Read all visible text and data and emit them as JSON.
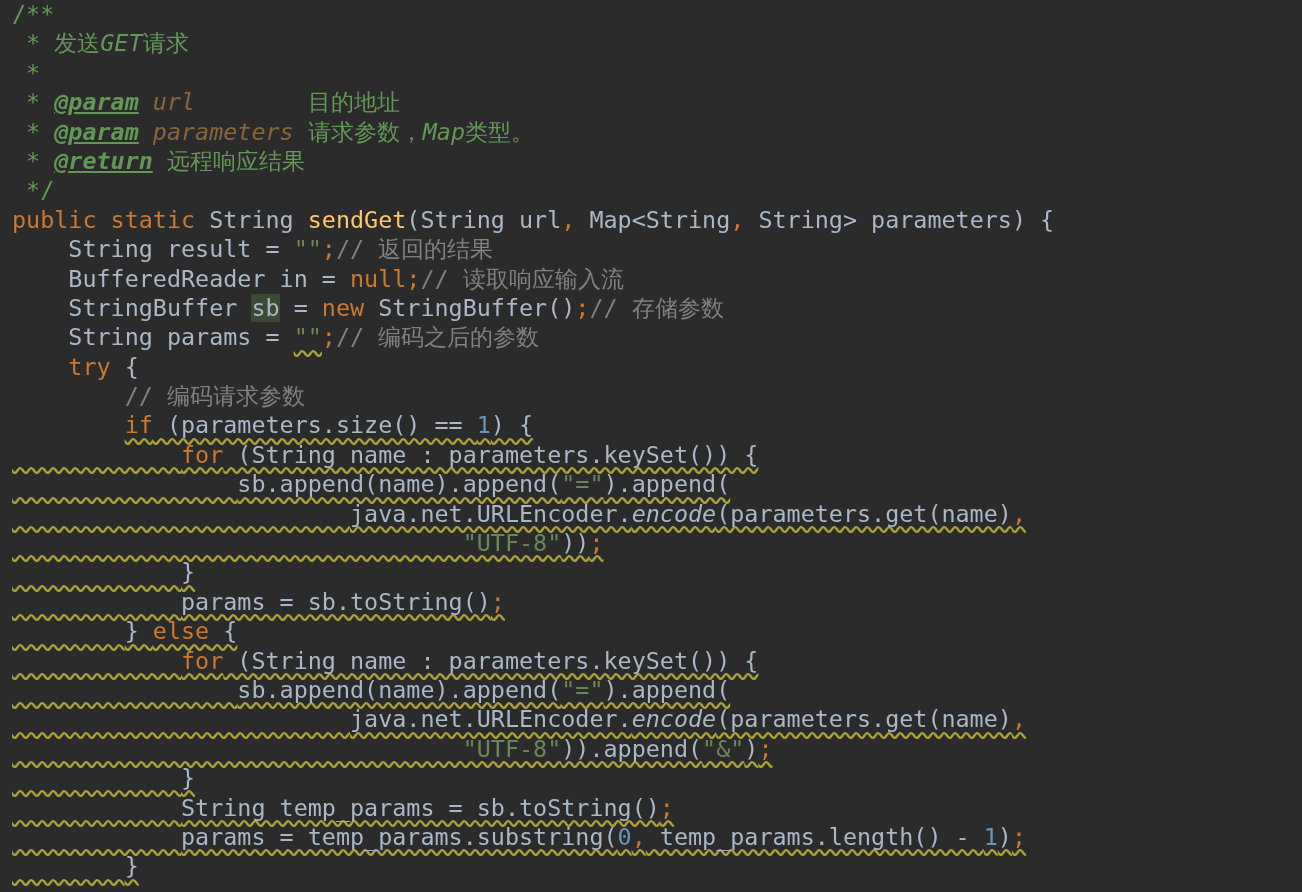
{
  "editor": {
    "lines": [
      {
        "tokens": [
          {
            "text": "/**",
            "kind": "doc"
          }
        ]
      },
      {
        "indent_warning": false,
        "tokens": [
          {
            "text": " * 发送",
            "kind": "doc"
          },
          {
            "text": "GET",
            "kind": "doc-code"
          },
          {
            "text": "请求",
            "kind": "doc"
          }
        ]
      },
      {
        "indent_warning": false,
        "tokens": [
          {
            "text": " *",
            "kind": "doc"
          }
        ]
      },
      {
        "indent_warning": false,
        "tokens": [
          {
            "text": " * ",
            "kind": "doc"
          },
          {
            "text": "@param",
            "kind": "doc-tag"
          },
          {
            "text": " url",
            "kind": "doc-param"
          },
          {
            "text": "        目的地址",
            "kind": "doc"
          }
        ]
      },
      {
        "indent_warning": false,
        "tokens": [
          {
            "text": " * ",
            "kind": "doc"
          },
          {
            "text": "@param",
            "kind": "doc-tag"
          },
          {
            "text": " parameters",
            "kind": "doc-param"
          },
          {
            "text": " 请求参数，",
            "kind": "doc"
          },
          {
            "text": "Map",
            "kind": "doc-code"
          },
          {
            "text": "类型。",
            "kind": "doc"
          }
        ]
      },
      {
        "indent_warning": false,
        "tokens": [
          {
            "text": " * ",
            "kind": "doc"
          },
          {
            "text": "@return",
            "kind": "doc-tag"
          },
          {
            "text": " 远程响应结果",
            "kind": "doc"
          }
        ]
      },
      {
        "indent_warning": false,
        "tokens": [
          {
            "text": " */",
            "kind": "doc"
          }
        ]
      },
      {
        "tokens": [
          {
            "text": "public static",
            "kind": "keyword"
          },
          {
            "text": " String ",
            "kind": "plain"
          },
          {
            "text": "sendGet",
            "kind": "function"
          },
          {
            "text": "(String url",
            "kind": "plain"
          },
          {
            "text": ",",
            "kind": "keyword"
          },
          {
            "text": " Map<String",
            "kind": "plain"
          },
          {
            "text": ",",
            "kind": "keyword"
          },
          {
            "text": " String> parameters) {",
            "kind": "plain"
          }
        ]
      },
      {
        "indent_warning": false,
        "tokens": [
          {
            "text": "    String result = ",
            "kind": "plain"
          },
          {
            "text": "\"\"",
            "kind": "string"
          },
          {
            "text": ";",
            "kind": "keyword"
          },
          {
            "text": "// 返回的结果",
            "kind": "comment"
          }
        ]
      },
      {
        "indent_warning": false,
        "tokens": [
          {
            "text": "    BufferedReader in = ",
            "kind": "plain"
          },
          {
            "text": "null;",
            "kind": "keyword"
          },
          {
            "text": "// 读取响应输入流",
            "kind": "comment"
          }
        ]
      },
      {
        "indent_warning": false,
        "tokens": [
          {
            "text": "    StringBuffer ",
            "kind": "plain"
          },
          {
            "text": "sb",
            "kind": "highlight"
          },
          {
            "text": " = ",
            "kind": "plain"
          },
          {
            "text": "new",
            "kind": "keyword"
          },
          {
            "text": " StringBuffer()",
            "kind": "plain"
          },
          {
            "text": ";",
            "kind": "keyword"
          },
          {
            "text": "// 存储参数",
            "kind": "comment"
          }
        ]
      },
      {
        "indent_warning": false,
        "tokens": [
          {
            "text": "    String params = ",
            "kind": "plain"
          },
          {
            "text": "\"\"",
            "kind": "string",
            "warning": true
          },
          {
            "text": ";",
            "kind": "keyword"
          },
          {
            "text": "// 编码之后的参数",
            "kind": "comment"
          }
        ]
      },
      {
        "indent_warning": false,
        "tokens": [
          {
            "text": "    try",
            "kind": "keyword"
          },
          {
            "text": " {",
            "kind": "plain"
          }
        ]
      },
      {
        "indent_warning": false,
        "tokens": [
          {
            "text": "        // 编码请求参数",
            "kind": "comment"
          }
        ]
      },
      {
        "indent_warning": false,
        "tokens": [
          {
            "text": "        if",
            "kind": "keyword",
            "warning": true
          },
          {
            "text": " (parameters.size() == ",
            "kind": "plain",
            "warning": true
          },
          {
            "text": "1",
            "kind": "number",
            "warning": true
          },
          {
            "text": ") {",
            "kind": "plain",
            "warning": true
          }
        ]
      },
      {
        "indent_warning": true,
        "tokens": [
          {
            "text": "            for",
            "kind": "keyword",
            "warning": true
          },
          {
            "text": " (String name : parameters.keySet()) {",
            "kind": "plain",
            "warning": true
          }
        ]
      },
      {
        "indent_warning": true,
        "tokens": [
          {
            "text": "                sb.append(name).append(",
            "kind": "plain",
            "warning": true
          },
          {
            "text": "\"=\"",
            "kind": "string",
            "warning": true
          },
          {
            "text": ").append(",
            "kind": "plain",
            "warning": true
          }
        ]
      },
      {
        "indent_warning": true,
        "tokens": [
          {
            "text": "                        java.net.URLEncoder.",
            "kind": "plain",
            "warning": true
          },
          {
            "text": "encode",
            "kind": "static-call",
            "warning": true
          },
          {
            "text": "(parameters.get(name)",
            "kind": "plain",
            "warning": true
          },
          {
            "text": ",",
            "kind": "keyword",
            "warning": true
          }
        ]
      },
      {
        "indent_warning": true,
        "tokens": [
          {
            "text": "                                \"UTF-8\"",
            "kind": "string",
            "warning": true
          },
          {
            "text": "))",
            "kind": "plain",
            "warning": true
          },
          {
            "text": ";",
            "kind": "keyword",
            "warning": true
          }
        ]
      },
      {
        "indent_warning": true,
        "tokens": [
          {
            "text": "            }",
            "kind": "plain",
            "warning": true
          }
        ]
      },
      {
        "indent_warning": true,
        "tokens": [
          {
            "text": "            params = sb.toString()",
            "kind": "plain",
            "warning": true
          },
          {
            "text": ";",
            "kind": "keyword",
            "warning": true
          }
        ]
      },
      {
        "indent_warning": true,
        "tokens": [
          {
            "text": "        } ",
            "kind": "plain",
            "warning": true
          },
          {
            "text": "else",
            "kind": "keyword",
            "warning": true
          },
          {
            "text": " {",
            "kind": "plain",
            "warning": true
          }
        ]
      },
      {
        "indent_warning": true,
        "tokens": [
          {
            "text": "            for",
            "kind": "keyword",
            "warning": true
          },
          {
            "text": " (String name : parameters.keySet()) {",
            "kind": "plain",
            "warning": true
          }
        ]
      },
      {
        "indent_warning": true,
        "tokens": [
          {
            "text": "                sb.append(name).append(",
            "kind": "plain",
            "warning": true
          },
          {
            "text": "\"=\"",
            "kind": "string",
            "warning": true
          },
          {
            "text": ").append(",
            "kind": "plain",
            "warning": true
          }
        ]
      },
      {
        "indent_warning": true,
        "tokens": [
          {
            "text": "                        java.net.URLEncoder.",
            "kind": "plain",
            "warning": true
          },
          {
            "text": "encode",
            "kind": "static-call",
            "warning": true
          },
          {
            "text": "(parameters.get(name)",
            "kind": "plain",
            "warning": true
          },
          {
            "text": ",",
            "kind": "keyword",
            "warning": true
          }
        ]
      },
      {
        "indent_warning": true,
        "tokens": [
          {
            "text": "                                \"UTF-8\"",
            "kind": "string",
            "warning": true
          },
          {
            "text": ")).append(",
            "kind": "plain",
            "warning": true
          },
          {
            "text": "\"&\"",
            "kind": "string",
            "warning": true
          },
          {
            "text": ")",
            "kind": "plain",
            "warning": true
          },
          {
            "text": ";",
            "kind": "keyword",
            "warning": true
          }
        ]
      },
      {
        "indent_warning": true,
        "tokens": [
          {
            "text": "            }",
            "kind": "plain",
            "warning": true
          }
        ]
      },
      {
        "indent_warning": true,
        "tokens": [
          {
            "text": "            String temp_params = sb.toString()",
            "kind": "plain",
            "warning": true
          },
          {
            "text": ";",
            "kind": "keyword",
            "warning": true
          }
        ]
      },
      {
        "indent_warning": true,
        "tokens": [
          {
            "text": "            params = temp_params.substring(",
            "kind": "plain",
            "warning": true
          },
          {
            "text": "0",
            "kind": "number",
            "warning": true
          },
          {
            "text": ",",
            "kind": "keyword",
            "warning": true
          },
          {
            "text": " temp_params.length() - ",
            "kind": "plain",
            "warning": true
          },
          {
            "text": "1",
            "kind": "number",
            "warning": true
          },
          {
            "text": ")",
            "kind": "plain",
            "warning": true
          },
          {
            "text": ";",
            "kind": "keyword",
            "warning": true
          }
        ]
      },
      {
        "indent_warning": true,
        "tokens": [
          {
            "text": "        }",
            "kind": "plain",
            "warning": true
          }
        ]
      }
    ]
  }
}
